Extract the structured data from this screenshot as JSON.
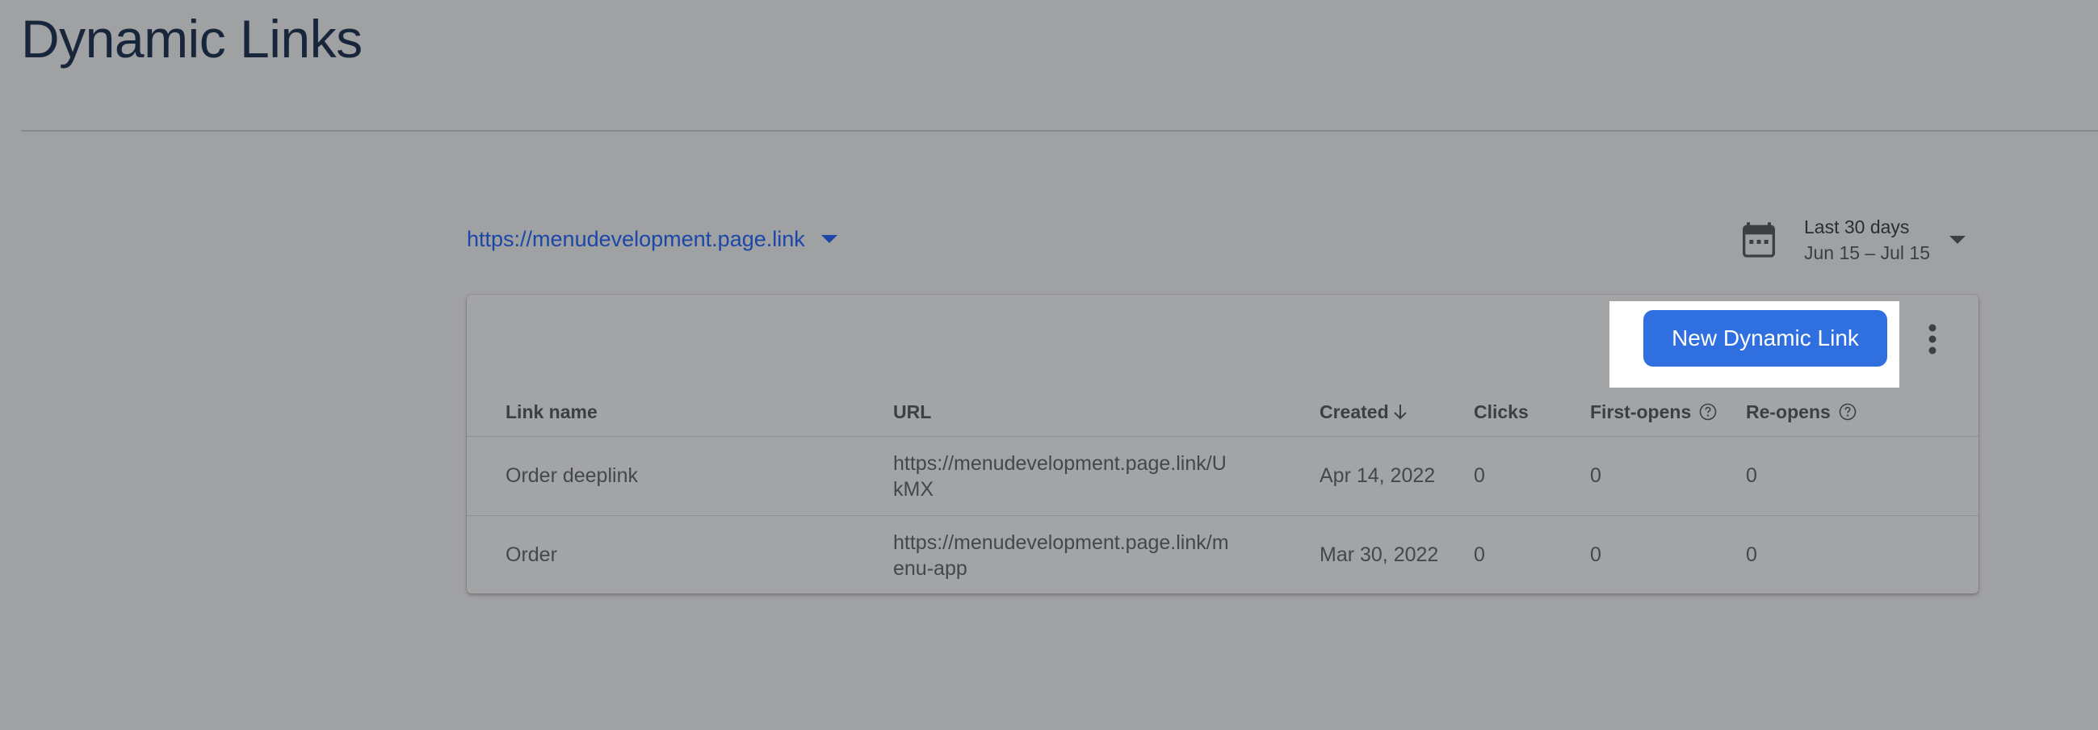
{
  "page": {
    "title": "Dynamic Links"
  },
  "domain_selector": {
    "value": "https://menudevelopment.page.link",
    "icon": "chevron-down-icon"
  },
  "date_range": {
    "label": "Last 30 days",
    "range": "Jun 15 – Jul 15",
    "icon": "calendar-icon"
  },
  "toolbar": {
    "new_link_label": "New Dynamic Link",
    "more_icon": "more-vert-icon"
  },
  "table": {
    "columns": [
      "Link name",
      "URL",
      "Created",
      "Clicks",
      "First-opens",
      "Re-opens"
    ],
    "sort_column": "Created",
    "sort_direction": "descending",
    "rows": [
      {
        "link_name": "Order deeplink",
        "url_line1": "https://menudevelopment.page.link/U",
        "url_line2": "kMX",
        "created": "Apr 14, 2022",
        "clicks": "0",
        "first_opens": "0",
        "re_opens": "0"
      },
      {
        "link_name": "Order",
        "url_line1": "https://menudevelopment.page.link/m",
        "url_line2": "enu-app",
        "created": "Mar 30, 2022",
        "clicks": "0",
        "first_opens": "0",
        "re_opens": "0"
      }
    ]
  },
  "colors": {
    "accent": "#2f6fdf",
    "link_text": "#1a47a8",
    "overlay_background": "#a0a1a3"
  }
}
